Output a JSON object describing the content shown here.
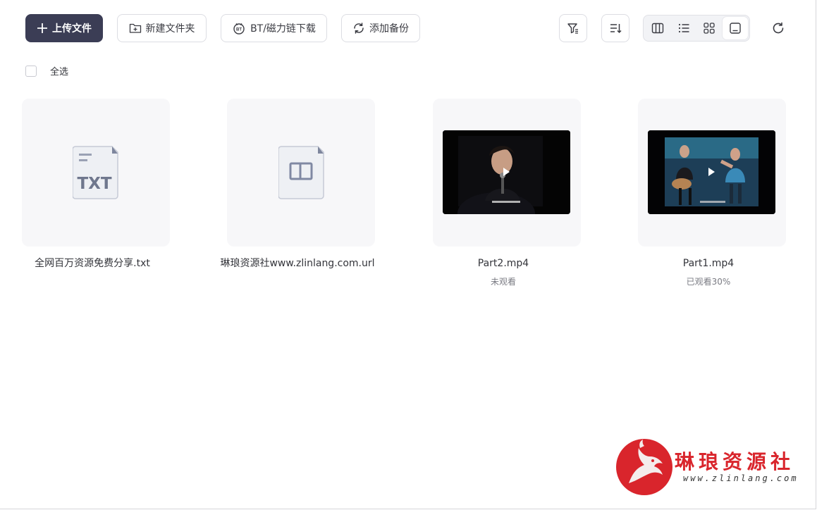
{
  "toolbar": {
    "upload_label": "上传文件",
    "new_folder_label": "新建文件夹",
    "bt_label": "BT/磁力链下载",
    "backup_label": "添加备份"
  },
  "selection": {
    "select_all_label": "全选"
  },
  "files": [
    {
      "name": "全网百万资源免费分享.txt",
      "type": "txt",
      "thumb_text": "TXT",
      "status": ""
    },
    {
      "name": "琳琅资源社www.zlinlang.com.url",
      "type": "url",
      "status": ""
    },
    {
      "name": "Part2.mp4",
      "type": "video",
      "status": "未观看"
    },
    {
      "name": "Part1.mp4",
      "type": "video",
      "status": "已观看30%"
    }
  ],
  "watermark": {
    "title": "琳琅资源社",
    "url": "www.zlinlang.com"
  },
  "colors": {
    "primary": "#3b3d55",
    "card_bg": "#f7f7f9",
    "logo_red": "#d9252c"
  }
}
